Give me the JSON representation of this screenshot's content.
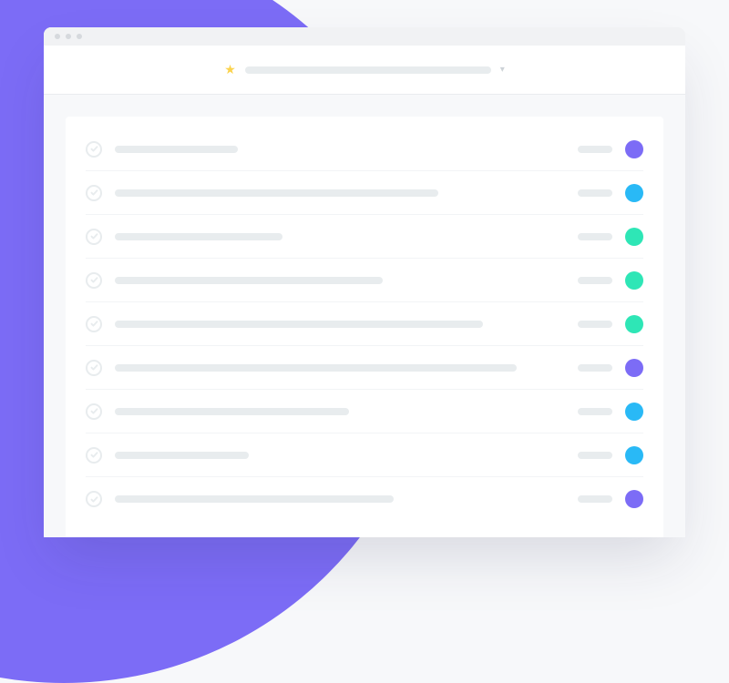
{
  "colors": {
    "purple": "#7C6CF6",
    "blue": "#29B9F6",
    "teal": "#2EE6B6"
  },
  "address_bar": {
    "starred": true
  },
  "tasks": [
    {
      "width_pct": 22,
      "avatar_color": "purple"
    },
    {
      "width_pct": 58,
      "avatar_color": "blue"
    },
    {
      "width_pct": 30,
      "avatar_color": "teal"
    },
    {
      "width_pct": 48,
      "avatar_color": "teal"
    },
    {
      "width_pct": 66,
      "avatar_color": "teal"
    },
    {
      "width_pct": 72,
      "avatar_color": "purple"
    },
    {
      "width_pct": 42,
      "avatar_color": "blue"
    },
    {
      "width_pct": 24,
      "avatar_color": "blue"
    },
    {
      "width_pct": 50,
      "avatar_color": "purple"
    }
  ]
}
